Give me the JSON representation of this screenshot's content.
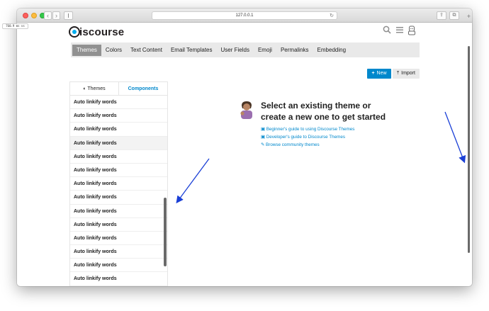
{
  "browser": {
    "url": "127.0.0.1",
    "reload_glyph": "↻",
    "back_glyph": "‹",
    "forward_glyph": "›",
    "share_glyph": "⇪",
    "tabs_glyph": "⧉",
    "newtab_glyph": "+"
  },
  "badge": "760.9 ms vs",
  "header": {
    "logo_text": "iscourse",
    "icons": [
      "search-icon",
      "hamburger-menu-icon",
      "user-avatar-icon"
    ]
  },
  "admin_nav": {
    "tabs": [
      "Themes",
      "Colors",
      "Text Content",
      "Email Templates",
      "User Fields",
      "Emoji",
      "Permalinks",
      "Embedding"
    ],
    "active": "Themes"
  },
  "actions": {
    "new_label": "New",
    "import_label": "Import"
  },
  "list": {
    "tabs": [
      "Themes",
      "Components"
    ],
    "selected_tab": "Components",
    "items": [
      "Auto linkify words",
      "Auto linkify words",
      "Auto linkify words",
      "Auto linkify words",
      "Auto linkify words",
      "Auto linkify words",
      "Auto linkify words",
      "Auto linkify words",
      "Auto linkify words",
      "Auto linkify words",
      "Auto linkify words",
      "Auto linkify words",
      "Auto linkify words",
      "Auto linkify words",
      "Auto linkify words"
    ],
    "highlighted_index": 3
  },
  "empty_state": {
    "title_line1": "Select an existing theme or",
    "title_line2": "create a new one to get started",
    "links": [
      "Beginner's guide to using Discourse Themes",
      "Developer's guide to Discourse Themes",
      "Browse community themes"
    ]
  },
  "colors": {
    "accent": "#0088cc",
    "nav_active": "#919191",
    "annotation_arrows": "#1a3fd6"
  }
}
